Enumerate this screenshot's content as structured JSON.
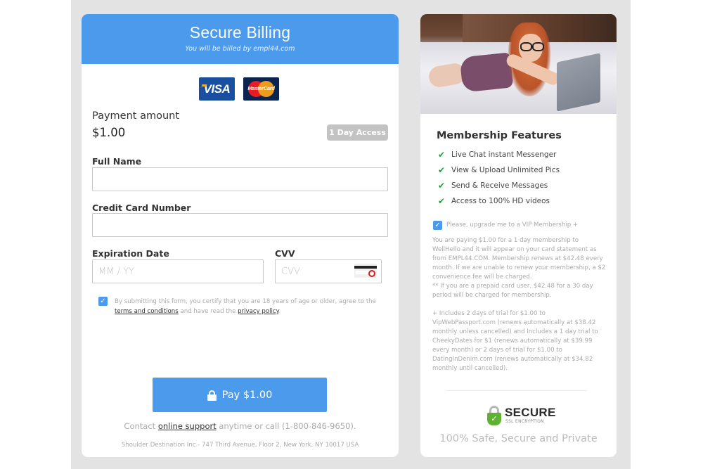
{
  "billing": {
    "title": "Secure Billing",
    "subtitle": "You will be billed by empl44.com",
    "card_logos": [
      {
        "name": "visa",
        "label": "VISA"
      },
      {
        "name": "mastercard",
        "label": "MasterCard"
      }
    ],
    "payment_label": "Payment amount",
    "payment_amount": "$1.00",
    "access_badge": "1 Day Access",
    "fields": {
      "full_name": {
        "label": "Full Name",
        "value": "",
        "placeholder": ""
      },
      "card_number": {
        "label": "Credit Card Number",
        "value": "",
        "placeholder": ""
      },
      "expiration": {
        "label": "Expiration Date",
        "value": "",
        "placeholder": "MM / YY"
      },
      "cvv": {
        "label": "CVV",
        "value": "",
        "placeholder": "CVV"
      }
    },
    "consent": {
      "checked": true,
      "text_before": "By submitting this form, you certify that you are 18 years of age or older, agree to the ",
      "terms_link": "terms and conditions",
      "text_middle": " and have read the ",
      "privacy_link": "privacy policy",
      "text_after": "."
    },
    "pay_button": "Pay $1.00",
    "contact": {
      "prefix": "Contact ",
      "link": "online support",
      "suffix": " anytime or call (1-800-846-9650)."
    },
    "address": "Shoulder Destination Inc - 747 Third Avenue, Floor 2, New York, NY 10017 USA"
  },
  "membership": {
    "title": "Membership Features",
    "features": [
      "Live Chat instant Messenger",
      "View & Upload Unlimited Pics",
      "Send & Receive Messages",
      "Access to 100% HD videos"
    ],
    "vip_upgrade": {
      "checked": true,
      "label": "Please, upgrade me to a VIP Membership +"
    },
    "disclaimer_1": "You are paying $1.00 for a 1 day membership to WellHello and it will appear on your card statement as from EMPL44.COM. Membership renews at $42.48 every month. If we are unable to renew your membership, a $2 convenience fee will be charged.",
    "disclaimer_2": "** If you are a prepaid card user, $42.48 for a 30 day period will be charged for membership.",
    "disclaimer_3": "+ Includes 2 days of trial for $1.00 to VipWebPassport.com (renews automatically at $38.42 monthly unless cancelled) and Includes a 1 day trial to CheekyDates for $1 (renews automatically at $39.99 every month) or 2 days of trial for $1.00 to DatingInDenim.com (renews automatically at $34.82 monthly until cancelled).",
    "ssl_badge": {
      "title": "SECURE",
      "subtitle": "SSL ENCRYPTION"
    },
    "safe_text": "100% Safe, Secure and Private"
  },
  "colors": {
    "accent": "#4c9aec",
    "check_green": "#1fa13a",
    "badge_gray": "#c3c3c3",
    "page_gray": "#e3e3e3"
  }
}
